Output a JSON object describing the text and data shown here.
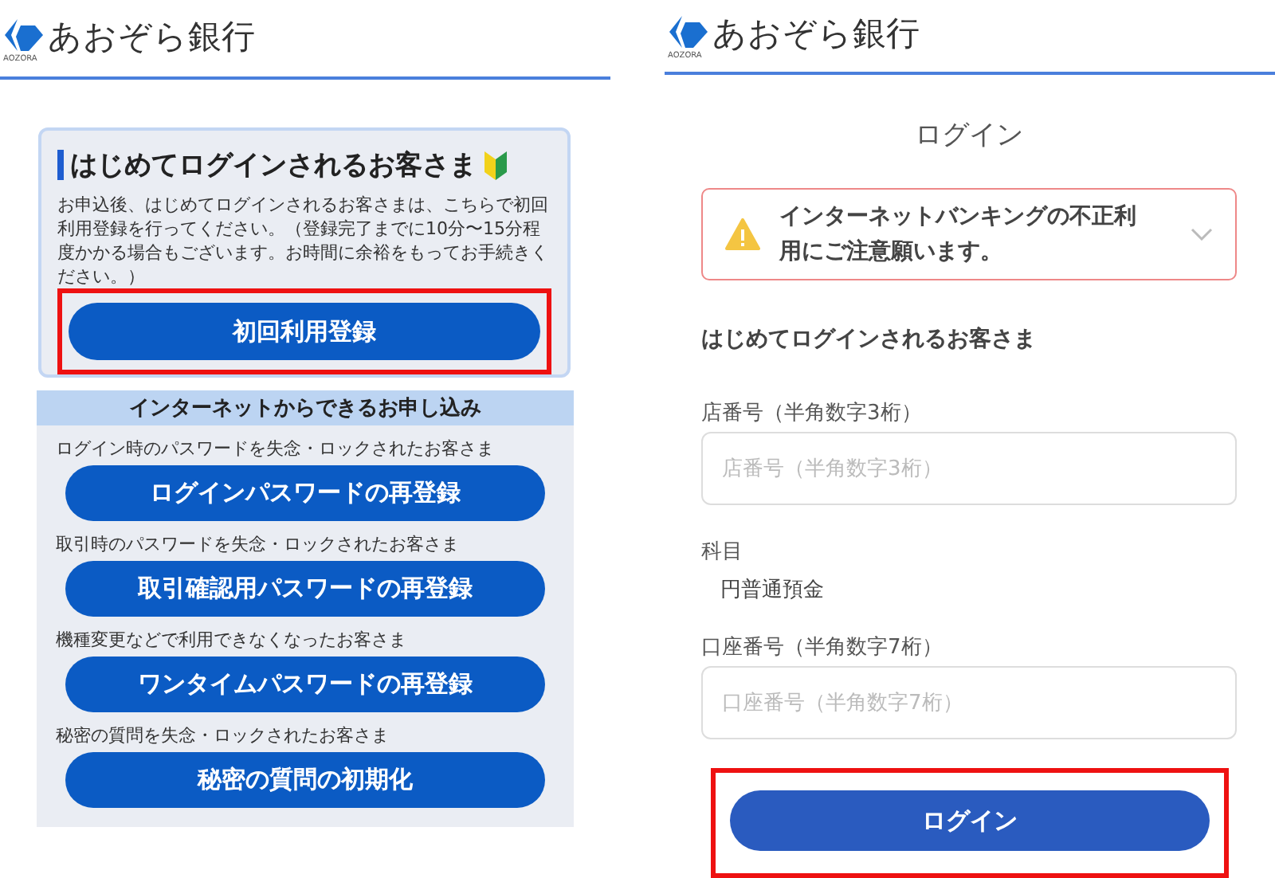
{
  "registration_screen": {
    "logo": {
      "name": "あおぞら銀行",
      "sub": "AOZORA"
    },
    "first_login_card": {
      "title": "はじめてログインされるお客さま",
      "text": "お申込後、はじめてログインされるお客さまは、こちらで初回利用登録を行ってください。（登録完了までに10分〜15分程度かかる場合もございます。お時間に余裕をもってお手続きください。）",
      "button": {
        "label": "初回利用登録",
        "highlighted": true
      }
    },
    "online_section": {
      "title": "インターネットからできるお申し込み",
      "items": [
        {
          "caption": "ログイン時のパスワードを失念・ロックされたお客さま",
          "button": "ログインパスワードの再登録"
        },
        {
          "caption": "取引時のパスワードを失念・ロックされたお客さま",
          "button": "取引確認用パスワードの再登録"
        },
        {
          "caption": "機種変更などで利用できなくなったお客さま",
          "button": "ワンタイムパスワードの再登録"
        },
        {
          "caption": "秘密の質問を失念・ロックされたお客さま",
          "button": "秘密の質問の初期化"
        }
      ]
    }
  },
  "login_screen": {
    "logo": {
      "name": "あおぞら銀行",
      "sub": "AOZORA"
    },
    "title": "ログイン",
    "alert": {
      "text": "インターネットバンキングの不正利用にご注意願います。",
      "expanded": false
    },
    "heading": "はじめてログインされるお客さま",
    "fields": [
      {
        "kind": "input",
        "label": "店番号（半角数字3桁）",
        "placeholder": "店番号（半角数字3桁）"
      },
      {
        "kind": "static",
        "label": "科目",
        "value": "円普通預金"
      },
      {
        "kind": "input",
        "label": "口座番号（半角数字7桁）",
        "placeholder": "口座番号（半角数字7桁）"
      }
    ],
    "button": {
      "label": "ログイン",
      "highlighted": true
    }
  }
}
